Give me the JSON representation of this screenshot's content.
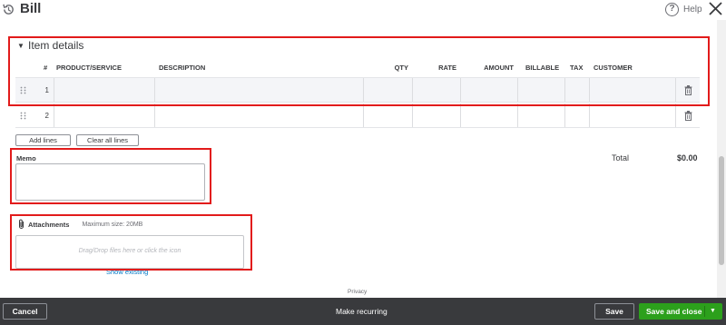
{
  "header": {
    "title": "Bill",
    "help_label": "Help",
    "history_icon": "history-icon",
    "help_icon_glyph": "?",
    "close_icon": "close-icon"
  },
  "item_details": {
    "section_title": "Item details",
    "columns": [
      "#",
      "PRODUCT/SERVICE",
      "DESCRIPTION",
      "QTY",
      "RATE",
      "AMOUNT",
      "BILLABLE",
      "TAX",
      "CUSTOMER"
    ],
    "rows": [
      {
        "num": "1"
      },
      {
        "num": "2"
      }
    ],
    "add_lines_label": "Add lines",
    "clear_lines_label": "Clear all lines"
  },
  "totals": {
    "total_label": "Total",
    "total_value": "$0.00"
  },
  "memo": {
    "label": "Memo",
    "value": ""
  },
  "attachments": {
    "label": "Attachments",
    "max_size": "Maximum size: 20MB",
    "drop_text": "Drag/Drop files here or click the icon",
    "show_existing": "Show existing"
  },
  "privacy_label": "Privacy",
  "footer": {
    "cancel_label": "Cancel",
    "make_recurring_label": "Make recurring",
    "save_label": "Save",
    "save_close_label": "Save and close"
  },
  "colors": {
    "highlight_box": "#e21b1b",
    "primary_green": "#2ca01c",
    "footer_bg": "#393a3d",
    "link_blue": "#0077c5"
  }
}
